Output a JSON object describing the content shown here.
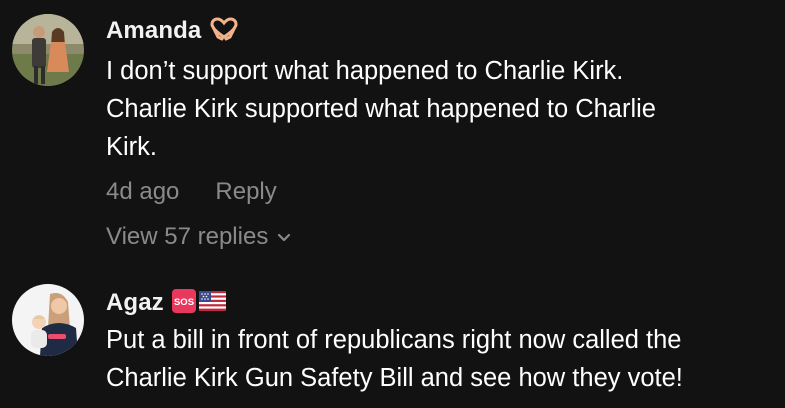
{
  "comments": [
    {
      "username": "Amanda",
      "badge_icons": [
        "heart-hands-icon"
      ],
      "text": "I don’t support what happened to Charlie Kirk.\nCharlie Kirk supported what happened to Charlie\nKirk.",
      "time": "4d ago",
      "reply_label": "Reply",
      "view_replies_label": "View 57 replies"
    },
    {
      "username": "Agaz",
      "badge_icons": [
        "sos-icon",
        "us-flag-icon"
      ],
      "text": "Put a bill in front of republicans right now called the\nCharlie Kirk Gun Safety Bill and see how they vote!"
    }
  ],
  "colors": {
    "background": "#121212",
    "primary_text": "#ffffff",
    "secondary_text": "#8a8a8a",
    "sos_badge": "#e8385e"
  }
}
